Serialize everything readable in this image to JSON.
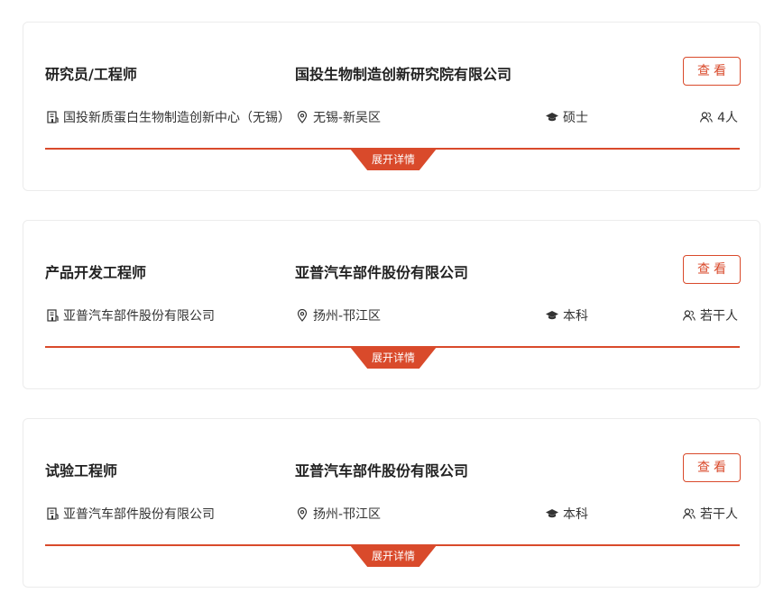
{
  "jobs": [
    {
      "title": "研究员/工程师",
      "company": "国投生物制造创新研究院有限公司",
      "view_label": "查看",
      "org": "国投新质蛋白生物制造创新中心（无锡）",
      "location": "无锡-新吴区",
      "education": "硕士",
      "headcount": "4人",
      "expand_label": "展开详情"
    },
    {
      "title": "产品开发工程师",
      "company": "亚普汽车部件股份有限公司",
      "view_label": "查看",
      "org": "亚普汽车部件股份有限公司",
      "location": "扬州-邗江区",
      "education": "本科",
      "headcount": "若干人",
      "expand_label": "展开详情"
    },
    {
      "title": "试验工程师",
      "company": "亚普汽车部件股份有限公司",
      "view_label": "查看",
      "org": "亚普汽车部件股份有限公司",
      "location": "扬州-邗江区",
      "education": "本科",
      "headcount": "若干人",
      "expand_label": "展开详情"
    }
  ],
  "icons": {
    "org": "building-icon",
    "location": "location-pin-icon",
    "education": "graduation-cap-icon",
    "headcount": "people-icon"
  },
  "colors": {
    "accent": "#d94a2b",
    "border": "#ececec",
    "text": "#222222"
  }
}
